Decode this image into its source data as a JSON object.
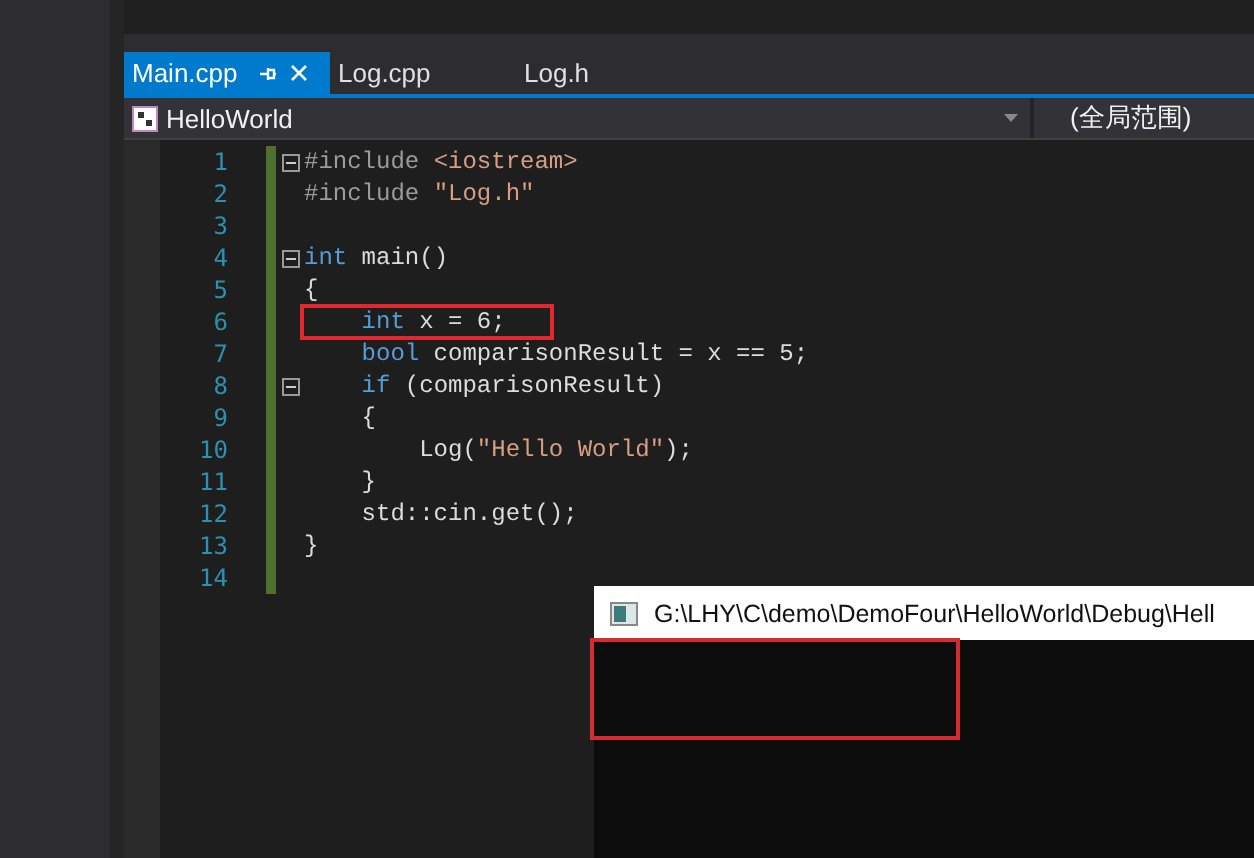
{
  "tabs": [
    {
      "label": "Main.cpp",
      "selected": true
    },
    {
      "label": "Log.cpp",
      "selected": false
    },
    {
      "label": "Log.h",
      "selected": false
    }
  ],
  "navigation": {
    "project": "HelloWorld",
    "scope": "(全局范围)"
  },
  "code_lines": [
    {
      "number": "1",
      "fold": true,
      "highlighted": false,
      "tokens": [
        {
          "text": "#include ",
          "kind": "preproc"
        },
        {
          "text": "<iostream>",
          "kind": "string"
        }
      ]
    },
    {
      "number": "2",
      "fold": false,
      "highlighted": false,
      "tokens": [
        {
          "text": "#include ",
          "kind": "preproc"
        },
        {
          "text": "\"Log.h\"",
          "kind": "string"
        }
      ]
    },
    {
      "number": "3",
      "fold": false,
      "highlighted": false
    },
    {
      "number": "4",
      "fold": true,
      "highlighted": false,
      "tokens": [
        {
          "text": "int",
          "kind": "keyword"
        },
        {
          "text": " main()",
          "kind": "plain"
        }
      ]
    },
    {
      "number": "5",
      "fold": false,
      "highlighted": false,
      "tokens": [
        {
          "text": "{",
          "kind": "plain"
        }
      ]
    },
    {
      "number": "6",
      "fold": false,
      "highlighted": true,
      "tokens": [
        {
          "text": "    int",
          "kind": "keyword"
        },
        {
          "text": " x = 6;",
          "kind": "plain"
        }
      ]
    },
    {
      "number": "7",
      "fold": false,
      "highlighted": false,
      "tokens": [
        {
          "text": "    bool",
          "kind": "keyword"
        },
        {
          "text": " comparisonResult = x == 5;",
          "kind": "plain"
        }
      ]
    },
    {
      "number": "8",
      "fold": true,
      "highlighted": false,
      "tokens": [
        {
          "text": "    if",
          "kind": "keyword"
        },
        {
          "text": " (comparisonResult)",
          "kind": "plain"
        }
      ]
    },
    {
      "number": "9",
      "fold": false,
      "highlighted": false,
      "tokens": [
        {
          "text": "    {",
          "kind": "plain"
        }
      ]
    },
    {
      "number": "10",
      "fold": false,
      "highlighted": false,
      "tokens": [
        {
          "text": "        Log(",
          "kind": "plain"
        },
        {
          "text": "\"Hello World\"",
          "kind": "string"
        },
        {
          "text": ");",
          "kind": "plain"
        }
      ]
    },
    {
      "number": "11",
      "fold": false,
      "highlighted": false,
      "tokens": [
        {
          "text": "    }",
          "kind": "plain"
        }
      ]
    },
    {
      "number": "12",
      "fold": false,
      "highlighted": false,
      "tokens": [
        {
          "text": "    std::cin.get();",
          "kind": "plain"
        }
      ]
    },
    {
      "number": "13",
      "fold": false,
      "highlighted": false,
      "tokens": [
        {
          "text": "}",
          "kind": "plain"
        }
      ]
    },
    {
      "number": "14",
      "fold": false,
      "highlighted": false
    }
  ],
  "console": {
    "title": "G:\\LHY\\C\\demo\\DemoFour\\HelloWorld\\Debug\\Hell",
    "highlighted": true
  }
}
